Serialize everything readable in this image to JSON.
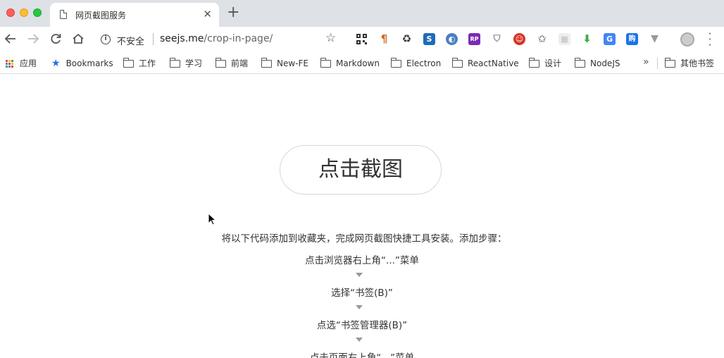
{
  "browser": {
    "tab_title": "网页截图服务",
    "tab_close": "✕",
    "new_tab": "+",
    "security_label": "不安全",
    "url_host": "seejs.me",
    "url_path": "/crop-in-page/",
    "more": "»"
  },
  "bookmarks": [
    {
      "label": "应用",
      "icon": "apps-icon"
    },
    {
      "label": "Bookmarks",
      "icon": "star-icon"
    },
    {
      "label": "工作",
      "icon": "folder-icon"
    },
    {
      "label": "学习",
      "icon": "folder-icon"
    },
    {
      "label": "前端",
      "icon": "folder-icon"
    },
    {
      "label": "New-FE",
      "icon": "folder-icon"
    },
    {
      "label": "Markdown",
      "icon": "folder-icon"
    },
    {
      "label": "Electron",
      "icon": "folder-icon"
    },
    {
      "label": "ReactNative",
      "icon": "folder-icon"
    },
    {
      "label": "设计",
      "icon": "folder-icon"
    },
    {
      "label": "NodeJS",
      "icon": "folder-icon"
    },
    {
      "label": "其他书签",
      "icon": "folder-icon"
    }
  ],
  "main": {
    "crop_button": "点击截图",
    "intro": "将以下代码添加到收藏夹，完成网页截图快捷工具安装。添加步骤：",
    "steps": [
      "点击浏览器右上角“...”菜单",
      "选择“书签(B)”",
      "点选“书签管理器(B)”",
      "点击页面右上角“...”菜单"
    ]
  }
}
